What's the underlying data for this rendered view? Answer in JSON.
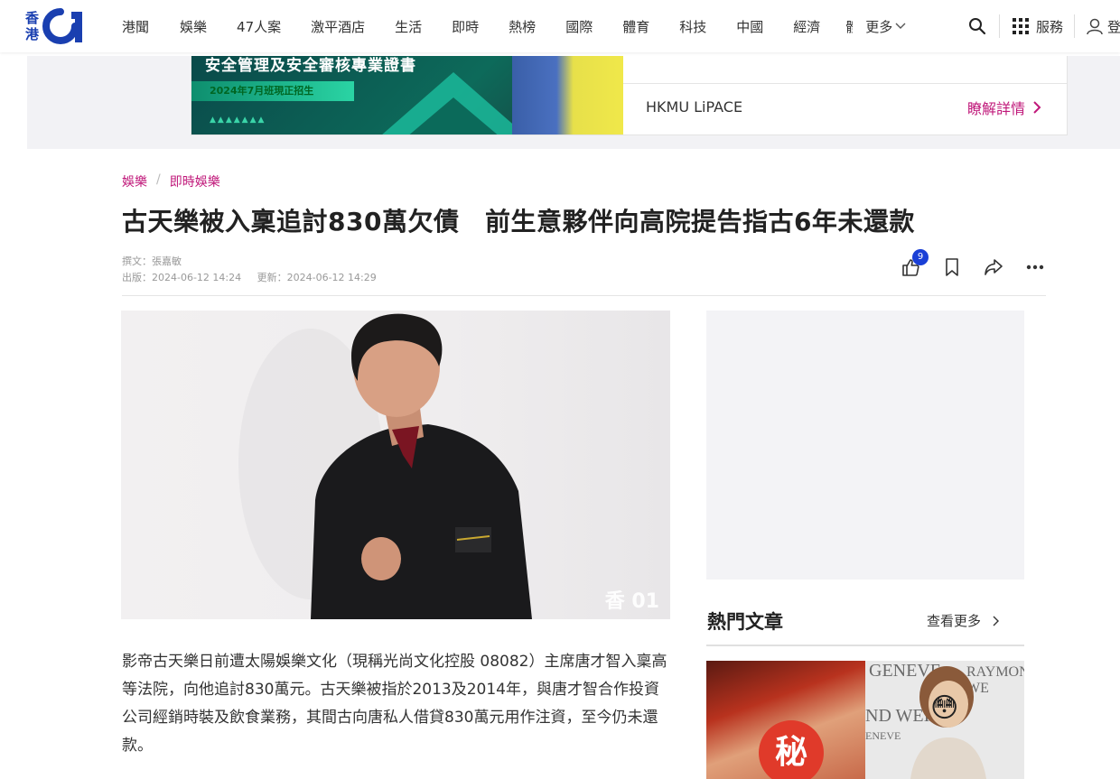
{
  "nav": {
    "logo_line1": "香",
    "logo_line2": "港",
    "items": [
      "港聞",
      "娛樂",
      "47人案",
      "激平酒店",
      "生活",
      "即時",
      "熱榜",
      "國際",
      "體育",
      "科技",
      "中國",
      "經濟",
      "體"
    ],
    "more_label": "更多",
    "services_label": "服務",
    "login_label": "登"
  },
  "ad": {
    "headline": "安全管理及安全審核專業證書",
    "tag": "2024年7月班現正招生",
    "dots": "▲▲▲▲▲▲▲",
    "brand": "HKMU LiPACE",
    "cta": "瞭解詳情"
  },
  "breadcrumb": {
    "level1": "娛樂",
    "separator": "/",
    "level2": "即時娛樂"
  },
  "article": {
    "title": "古天樂被入稟追討830萬欠債　前生意夥伴向高院提告指古6年未還款",
    "author": "撰文：張嘉敏",
    "published": "出版：2024-06-12 14:24",
    "updated": "更新：2024-06-12 14:29",
    "like_count": "9",
    "photo_watermark": "香 01",
    "body": "影帝古天樂日前遭太陽娛樂文化（現稱光尚文化控股 08082）主席唐才智入稟高等法院，向他追討830萬元。古天樂被指於2013及2014年，與唐才智合作投資公司經銷時裝及飲食業務，其間古向唐私人借貸830萬元用作注資，至今仍未還款。"
  },
  "sidebar": {
    "hot_title": "熱門文章",
    "hot_more": "查看更多",
    "thumb_text_1": "GENEVE",
    "thumb_text_2": "RAYMOND WE",
    "thumb_text_3": "ND WEI",
    "thumb_text_4": "ENEVE",
    "thumb_secret": "秘",
    "thumb_emoji": "😳"
  },
  "colors": {
    "brand_blue": "#1a3fb0",
    "accent_magenta": "#c0187a",
    "badge_blue": "#1a3fd6"
  }
}
